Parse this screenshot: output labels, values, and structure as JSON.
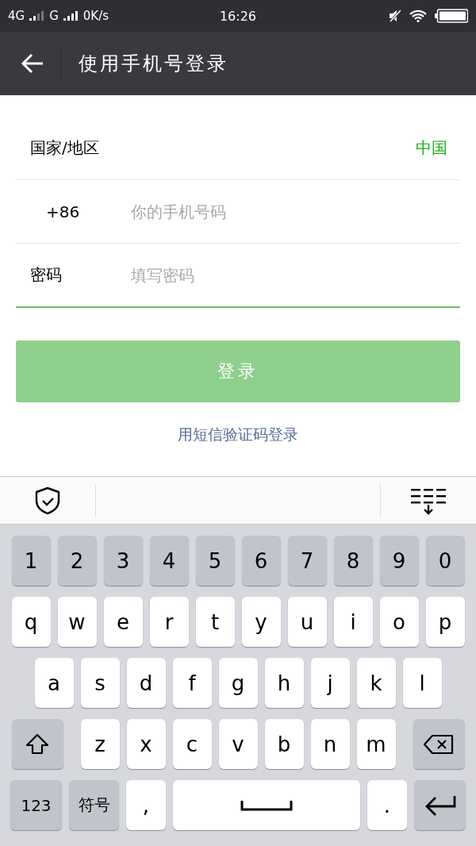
{
  "status_bar": {
    "networks": [
      {
        "label": "4G"
      },
      {
        "label": "G"
      }
    ],
    "speed": "0K/s",
    "time": "16:26"
  },
  "app_bar": {
    "title": "使用手机号登录"
  },
  "form": {
    "country": {
      "label": "国家/地区",
      "value": "中国"
    },
    "phone": {
      "prefix": "+86",
      "placeholder": "你的手机号码",
      "focused": false
    },
    "password": {
      "label": "密码",
      "placeholder": "填写密码",
      "focused": true
    },
    "login_button": {
      "label": "登录",
      "disabled": true
    },
    "sms_link": "用短信验证码登录"
  },
  "keyboard": {
    "rows": [
      [
        {
          "kind": "digit",
          "label": "1"
        },
        {
          "kind": "digit",
          "label": "2"
        },
        {
          "kind": "digit",
          "label": "3"
        },
        {
          "kind": "digit",
          "label": "4"
        },
        {
          "kind": "digit",
          "label": "5"
        },
        {
          "kind": "digit",
          "label": "6"
        },
        {
          "kind": "digit",
          "label": "7"
        },
        {
          "kind": "digit",
          "label": "8"
        },
        {
          "kind": "digit",
          "label": "9"
        },
        {
          "kind": "digit",
          "label": "0"
        }
      ],
      [
        {
          "kind": "letter",
          "label": "q"
        },
        {
          "kind": "letter",
          "label": "w"
        },
        {
          "kind": "letter",
          "label": "e"
        },
        {
          "kind": "letter",
          "label": "r"
        },
        {
          "kind": "letter",
          "label": "t"
        },
        {
          "kind": "letter",
          "label": "y"
        },
        {
          "kind": "letter",
          "label": "u"
        },
        {
          "kind": "letter",
          "label": "i"
        },
        {
          "kind": "letter",
          "label": "o"
        },
        {
          "kind": "letter",
          "label": "p"
        }
      ],
      [
        {
          "kind": "letter",
          "label": "a"
        },
        {
          "kind": "letter",
          "label": "s"
        },
        {
          "kind": "letter",
          "label": "d"
        },
        {
          "kind": "letter",
          "label": "f"
        },
        {
          "kind": "letter",
          "label": "g"
        },
        {
          "kind": "letter",
          "label": "h"
        },
        {
          "kind": "letter",
          "label": "j"
        },
        {
          "kind": "letter",
          "label": "k"
        },
        {
          "kind": "letter",
          "label": "l"
        }
      ],
      [
        {
          "kind": "shift"
        },
        {
          "kind": "letter",
          "label": "z"
        },
        {
          "kind": "letter",
          "label": "x"
        },
        {
          "kind": "letter",
          "label": "c"
        },
        {
          "kind": "letter",
          "label": "v"
        },
        {
          "kind": "letter",
          "label": "b"
        },
        {
          "kind": "letter",
          "label": "n"
        },
        {
          "kind": "letter",
          "label": "m"
        },
        {
          "kind": "backspace"
        }
      ],
      [
        {
          "kind": "function",
          "label": "123"
        },
        {
          "kind": "function",
          "label": "符号"
        },
        {
          "kind": "punct",
          "label": ","
        },
        {
          "kind": "space"
        },
        {
          "kind": "punct",
          "label": "."
        },
        {
          "kind": "enter"
        }
      ]
    ]
  }
}
